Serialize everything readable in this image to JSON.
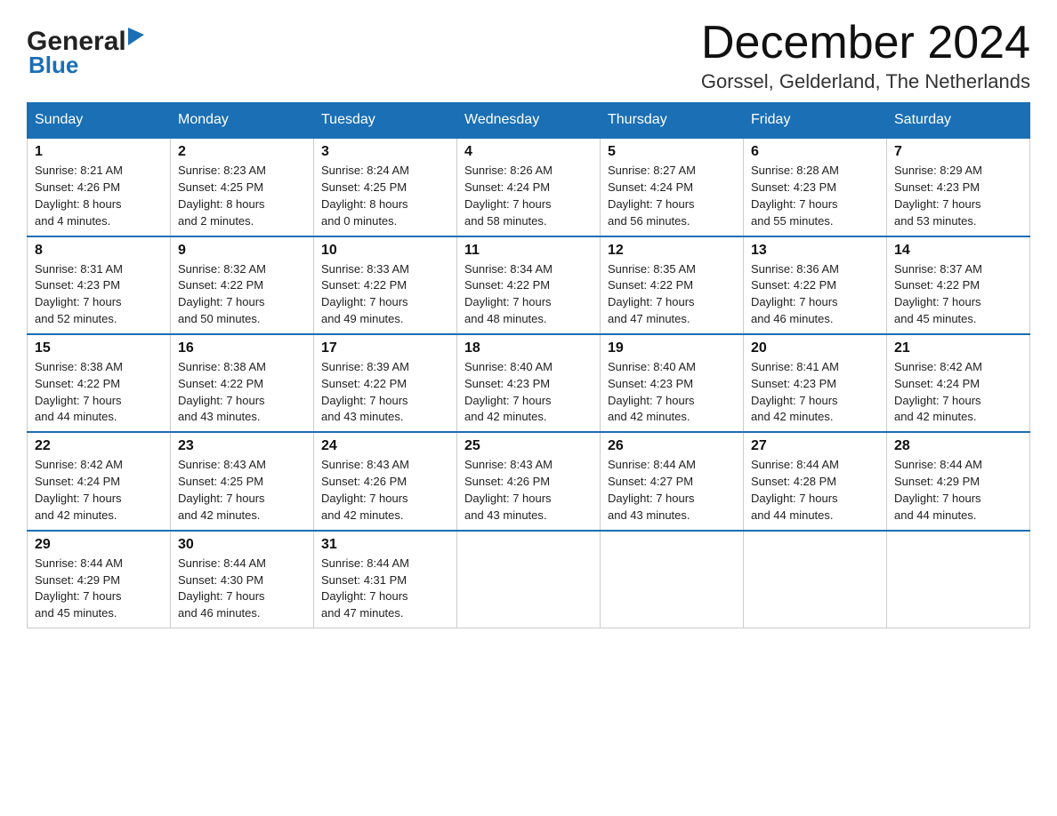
{
  "logo": {
    "name_black": "General",
    "triangle": "▶",
    "name_blue": "Blue"
  },
  "title": "December 2024",
  "subtitle": "Gorssel, Gelderland, The Netherlands",
  "days_of_week": [
    "Sunday",
    "Monday",
    "Tuesday",
    "Wednesday",
    "Thursday",
    "Friday",
    "Saturday"
  ],
  "weeks": [
    [
      {
        "day": "1",
        "sunrise": "Sunrise: 8:21 AM",
        "sunset": "Sunset: 4:26 PM",
        "daylight": "Daylight: 8 hours",
        "daylight2": "and 4 minutes."
      },
      {
        "day": "2",
        "sunrise": "Sunrise: 8:23 AM",
        "sunset": "Sunset: 4:25 PM",
        "daylight": "Daylight: 8 hours",
        "daylight2": "and 2 minutes."
      },
      {
        "day": "3",
        "sunrise": "Sunrise: 8:24 AM",
        "sunset": "Sunset: 4:25 PM",
        "daylight": "Daylight: 8 hours",
        "daylight2": "and 0 minutes."
      },
      {
        "day": "4",
        "sunrise": "Sunrise: 8:26 AM",
        "sunset": "Sunset: 4:24 PM",
        "daylight": "Daylight: 7 hours",
        "daylight2": "and 58 minutes."
      },
      {
        "day": "5",
        "sunrise": "Sunrise: 8:27 AM",
        "sunset": "Sunset: 4:24 PM",
        "daylight": "Daylight: 7 hours",
        "daylight2": "and 56 minutes."
      },
      {
        "day": "6",
        "sunrise": "Sunrise: 8:28 AM",
        "sunset": "Sunset: 4:23 PM",
        "daylight": "Daylight: 7 hours",
        "daylight2": "and 55 minutes."
      },
      {
        "day": "7",
        "sunrise": "Sunrise: 8:29 AM",
        "sunset": "Sunset: 4:23 PM",
        "daylight": "Daylight: 7 hours",
        "daylight2": "and 53 minutes."
      }
    ],
    [
      {
        "day": "8",
        "sunrise": "Sunrise: 8:31 AM",
        "sunset": "Sunset: 4:23 PM",
        "daylight": "Daylight: 7 hours",
        "daylight2": "and 52 minutes."
      },
      {
        "day": "9",
        "sunrise": "Sunrise: 8:32 AM",
        "sunset": "Sunset: 4:22 PM",
        "daylight": "Daylight: 7 hours",
        "daylight2": "and 50 minutes."
      },
      {
        "day": "10",
        "sunrise": "Sunrise: 8:33 AM",
        "sunset": "Sunset: 4:22 PM",
        "daylight": "Daylight: 7 hours",
        "daylight2": "and 49 minutes."
      },
      {
        "day": "11",
        "sunrise": "Sunrise: 8:34 AM",
        "sunset": "Sunset: 4:22 PM",
        "daylight": "Daylight: 7 hours",
        "daylight2": "and 48 minutes."
      },
      {
        "day": "12",
        "sunrise": "Sunrise: 8:35 AM",
        "sunset": "Sunset: 4:22 PM",
        "daylight": "Daylight: 7 hours",
        "daylight2": "and 47 minutes."
      },
      {
        "day": "13",
        "sunrise": "Sunrise: 8:36 AM",
        "sunset": "Sunset: 4:22 PM",
        "daylight": "Daylight: 7 hours",
        "daylight2": "and 46 minutes."
      },
      {
        "day": "14",
        "sunrise": "Sunrise: 8:37 AM",
        "sunset": "Sunset: 4:22 PM",
        "daylight": "Daylight: 7 hours",
        "daylight2": "and 45 minutes."
      }
    ],
    [
      {
        "day": "15",
        "sunrise": "Sunrise: 8:38 AM",
        "sunset": "Sunset: 4:22 PM",
        "daylight": "Daylight: 7 hours",
        "daylight2": "and 44 minutes."
      },
      {
        "day": "16",
        "sunrise": "Sunrise: 8:38 AM",
        "sunset": "Sunset: 4:22 PM",
        "daylight": "Daylight: 7 hours",
        "daylight2": "and 43 minutes."
      },
      {
        "day": "17",
        "sunrise": "Sunrise: 8:39 AM",
        "sunset": "Sunset: 4:22 PM",
        "daylight": "Daylight: 7 hours",
        "daylight2": "and 43 minutes."
      },
      {
        "day": "18",
        "sunrise": "Sunrise: 8:40 AM",
        "sunset": "Sunset: 4:23 PM",
        "daylight": "Daylight: 7 hours",
        "daylight2": "and 42 minutes."
      },
      {
        "day": "19",
        "sunrise": "Sunrise: 8:40 AM",
        "sunset": "Sunset: 4:23 PM",
        "daylight": "Daylight: 7 hours",
        "daylight2": "and 42 minutes."
      },
      {
        "day": "20",
        "sunrise": "Sunrise: 8:41 AM",
        "sunset": "Sunset: 4:23 PM",
        "daylight": "Daylight: 7 hours",
        "daylight2": "and 42 minutes."
      },
      {
        "day": "21",
        "sunrise": "Sunrise: 8:42 AM",
        "sunset": "Sunset: 4:24 PM",
        "daylight": "Daylight: 7 hours",
        "daylight2": "and 42 minutes."
      }
    ],
    [
      {
        "day": "22",
        "sunrise": "Sunrise: 8:42 AM",
        "sunset": "Sunset: 4:24 PM",
        "daylight": "Daylight: 7 hours",
        "daylight2": "and 42 minutes."
      },
      {
        "day": "23",
        "sunrise": "Sunrise: 8:43 AM",
        "sunset": "Sunset: 4:25 PM",
        "daylight": "Daylight: 7 hours",
        "daylight2": "and 42 minutes."
      },
      {
        "day": "24",
        "sunrise": "Sunrise: 8:43 AM",
        "sunset": "Sunset: 4:26 PM",
        "daylight": "Daylight: 7 hours",
        "daylight2": "and 42 minutes."
      },
      {
        "day": "25",
        "sunrise": "Sunrise: 8:43 AM",
        "sunset": "Sunset: 4:26 PM",
        "daylight": "Daylight: 7 hours",
        "daylight2": "and 43 minutes."
      },
      {
        "day": "26",
        "sunrise": "Sunrise: 8:44 AM",
        "sunset": "Sunset: 4:27 PM",
        "daylight": "Daylight: 7 hours",
        "daylight2": "and 43 minutes."
      },
      {
        "day": "27",
        "sunrise": "Sunrise: 8:44 AM",
        "sunset": "Sunset: 4:28 PM",
        "daylight": "Daylight: 7 hours",
        "daylight2": "and 44 minutes."
      },
      {
        "day": "28",
        "sunrise": "Sunrise: 8:44 AM",
        "sunset": "Sunset: 4:29 PM",
        "daylight": "Daylight: 7 hours",
        "daylight2": "and 44 minutes."
      }
    ],
    [
      {
        "day": "29",
        "sunrise": "Sunrise: 8:44 AM",
        "sunset": "Sunset: 4:29 PM",
        "daylight": "Daylight: 7 hours",
        "daylight2": "and 45 minutes."
      },
      {
        "day": "30",
        "sunrise": "Sunrise: 8:44 AM",
        "sunset": "Sunset: 4:30 PM",
        "daylight": "Daylight: 7 hours",
        "daylight2": "and 46 minutes."
      },
      {
        "day": "31",
        "sunrise": "Sunrise: 8:44 AM",
        "sunset": "Sunset: 4:31 PM",
        "daylight": "Daylight: 7 hours",
        "daylight2": "and 47 minutes."
      },
      null,
      null,
      null,
      null
    ]
  ]
}
